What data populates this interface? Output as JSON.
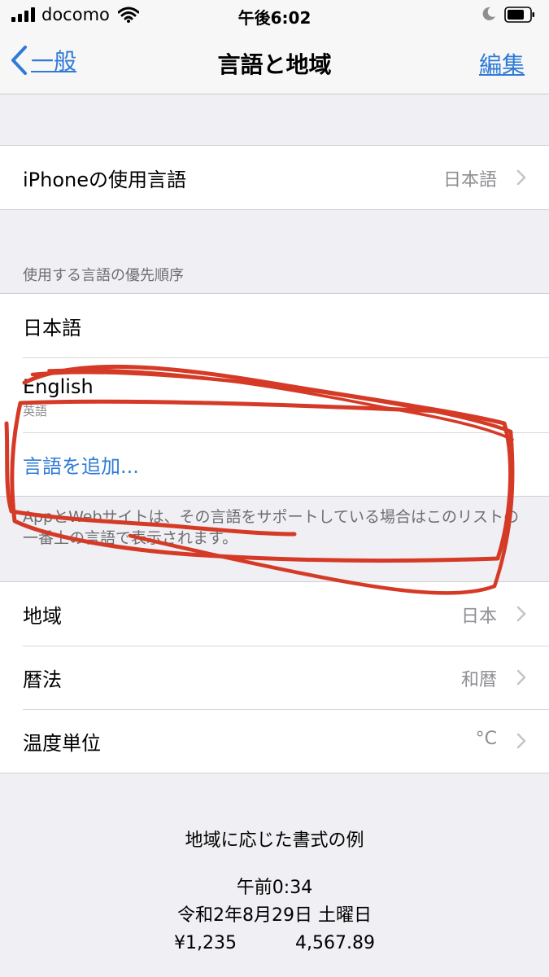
{
  "status": {
    "carrier": "docomo",
    "time": "午後6:02"
  },
  "nav": {
    "back_label": "一般",
    "title": "言語と地域",
    "edit_label": "編集"
  },
  "device_language": {
    "label": "iPhoneの使用言語",
    "value": "日本語"
  },
  "preferred": {
    "header": "使用する言語の優先順序",
    "languages": [
      {
        "name": "日本語"
      },
      {
        "name": "English",
        "sub": "英語"
      }
    ],
    "add_label": "言語を追加...",
    "footnote": "AppとWebサイトは、その言語をサポートしている場合はこのリストの一番上の言語で表示されます。"
  },
  "region_settings": [
    {
      "label": "地域",
      "value": "日本"
    },
    {
      "label": "暦法",
      "value": "和暦"
    },
    {
      "label": "温度単位",
      "value": "°C"
    }
  ],
  "format_example": {
    "title": "地域に応じた書式の例",
    "time": "午前0:34",
    "date": "令和2年8月29日 土曜日",
    "currency": "¥1,235",
    "number": "4,567.89"
  },
  "colors": {
    "accent": "#2f7bd6",
    "annotation": "#d53a26",
    "background": "#efeff4"
  }
}
